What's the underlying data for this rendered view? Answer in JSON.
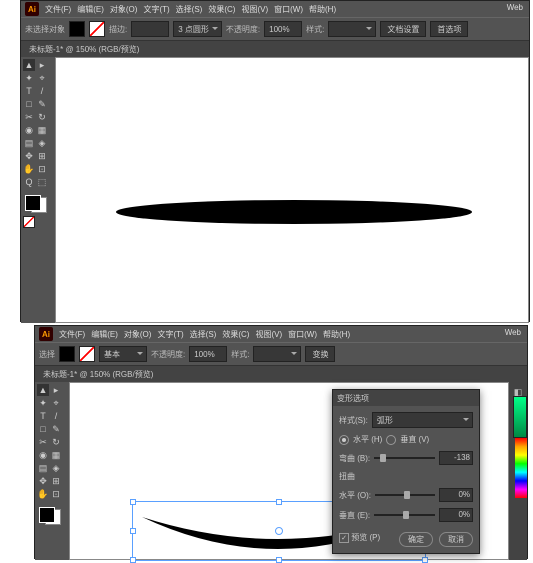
{
  "app1": {
    "logo": "Ai",
    "menus": [
      "文件(F)",
      "编辑(E)",
      "对象(O)",
      "文字(T)",
      "选择(S)",
      "效果(C)",
      "视图(V)",
      "窗口(W)",
      "帮助(H)"
    ],
    "web_mode": "Web",
    "ctrl": {
      "no_selection": "未选择对象",
      "stroke_label": "描边:",
      "stroke_val": "",
      "shape_label": "3 点圆形",
      "opacity_label": "不透明度:",
      "opacity_val": "100%",
      "style_label": "样式:",
      "doc_setup": "文档设置",
      "prefs": "首选项"
    },
    "doc_tab": "未标题-1* @ 150% (RGB/预览)"
  },
  "app2": {
    "logo": "Ai",
    "menus": [
      "文件(F)",
      "编辑(E)",
      "对象(O)",
      "文字(T)",
      "选择(S)",
      "效果(C)",
      "视图(V)",
      "窗口(W)",
      "帮助(H)"
    ],
    "web_mode": "Web",
    "ctrl": {
      "sel": "选择",
      "basic": "基本",
      "opacity_label": "不透明度:",
      "opacity_val": "100%",
      "style_label": "样式:",
      "transform": "变换"
    },
    "doc_tab": "未标题-1* @ 150% (RGB/预览)",
    "dialog": {
      "title": "变形选项",
      "style_label": "样式(S):",
      "style_val": "弧形",
      "horiz": "水平 (H)",
      "vert": "垂直 (V)",
      "bend_label": "弯曲 (B):",
      "bend_val": "-138",
      "distort_label": "扭曲",
      "hdist_label": "水平 (O):",
      "hdist_val": "0%",
      "vdist_label": "垂直 (E):",
      "vdist_val": "0%",
      "preview": "预览 (P)",
      "ok": "确定",
      "cancel": "取消"
    }
  },
  "tools": [
    "▲",
    "▸",
    "✦",
    "⌖",
    "T",
    "/",
    "□",
    "✎",
    "✂",
    "↻",
    "◉",
    "▦",
    "▤",
    "◈",
    "✥",
    "⊞",
    "✋",
    "⊡",
    "Q",
    "⬚"
  ]
}
